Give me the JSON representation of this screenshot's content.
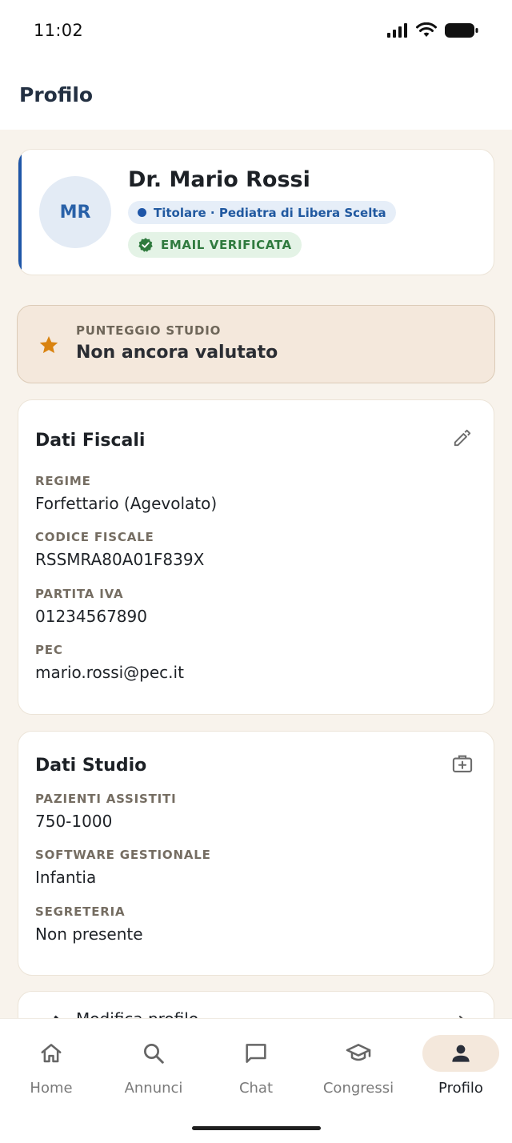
{
  "status_bar": {
    "time": "11:02"
  },
  "header": {
    "title": "Profilo"
  },
  "profile": {
    "initials": "MR",
    "name": "Dr. Mario Rossi",
    "role": "Titolare · Pediatra di Libera Scelta",
    "verified_label": "EMAIL VERIFICATA"
  },
  "score": {
    "label": "PUNTEGGIO STUDIO",
    "value": "Non ancora valutato"
  },
  "fiscal": {
    "title": "Dati Fiscali",
    "fields": [
      {
        "label": "REGIME",
        "value": "Forfettario (Agevolato)"
      },
      {
        "label": "CODICE FISCALE",
        "value": "RSSMRA80A01F839X"
      },
      {
        "label": "PARTITA IVA",
        "value": "01234567890"
      },
      {
        "label": "PEC",
        "value": "mario.rossi@pec.it"
      }
    ]
  },
  "studio": {
    "title": "Dati Studio",
    "fields": [
      {
        "label": "PAZIENTI ASSISTITI",
        "value": "750-1000"
      },
      {
        "label": "SOFTWARE GESTIONALE",
        "value": "Infantia"
      },
      {
        "label": "SEGRETERIA",
        "value": "Non presente"
      }
    ]
  },
  "menu": {
    "edit_profile": "Modifica profilo"
  },
  "nav": {
    "items": [
      {
        "label": "Home",
        "icon": "home-icon"
      },
      {
        "label": "Annunci",
        "icon": "search-icon"
      },
      {
        "label": "Chat",
        "icon": "chat-icon"
      },
      {
        "label": "Congressi",
        "icon": "graduation-cap-icon"
      },
      {
        "label": "Profilo",
        "icon": "person-icon",
        "active": true
      }
    ]
  },
  "colors": {
    "accent": "#1f56a8",
    "background": "#f8f3ec",
    "verified": "#2f7a3e",
    "star": "#d98310"
  }
}
